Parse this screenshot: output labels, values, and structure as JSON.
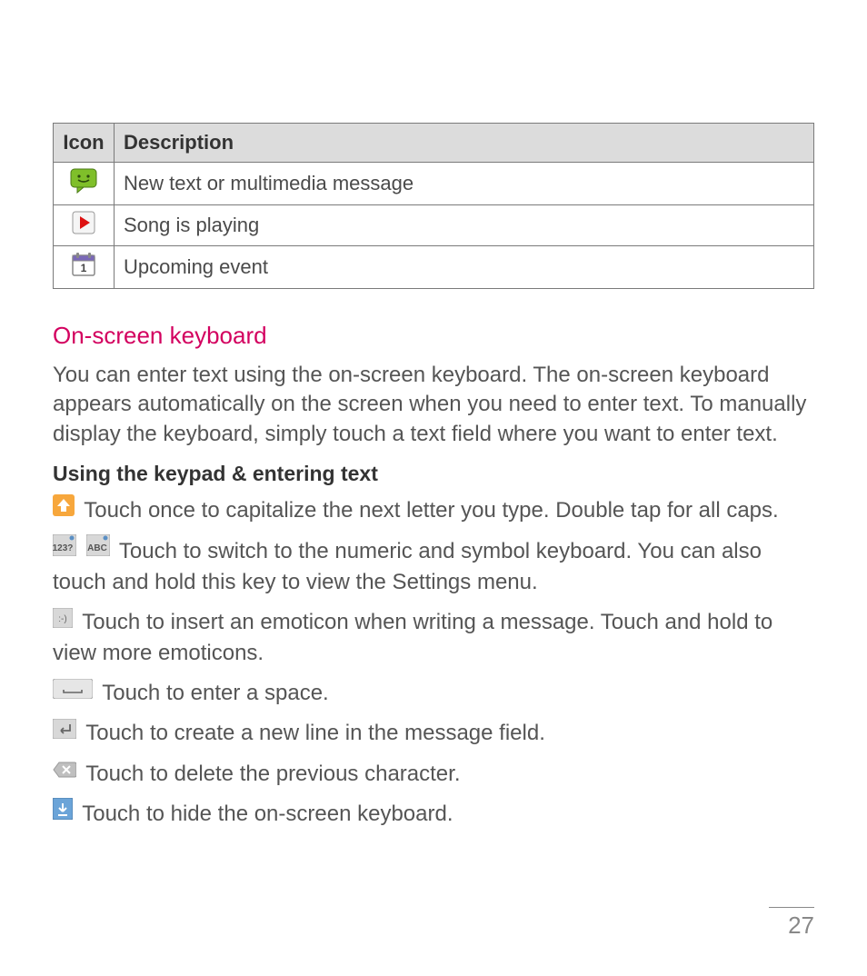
{
  "table": {
    "headers": {
      "icon": "Icon",
      "desc": "Description"
    },
    "rows": [
      {
        "desc": "New text or multimedia message"
      },
      {
        "desc": "Song is playing"
      },
      {
        "desc": "Upcoming event"
      }
    ]
  },
  "section": {
    "heading": "On-screen keyboard",
    "intro": "You can enter text using the on-screen keyboard. The on-screen keyboard appears automatically on the screen when you need to enter text. To manually display the keyboard, simply touch a text field where you want to enter text.",
    "subheading": "Using the keypad & entering text",
    "entries": {
      "shift": "Touch once to capitalize the next letter you type. Double tap for all caps.",
      "numeric": "Touch to switch to the numeric and symbol keyboard. You can also touch and hold this key to view the Settings menu.",
      "emoticon": "Touch to insert an emoticon when writing a message. Touch and hold to view more emoticons.",
      "space": "Touch to enter a space.",
      "newline": "Touch to create a new line in the message field.",
      "delete": "Touch to delete the previous character.",
      "hide": "Touch to hide the on-screen keyboard."
    }
  },
  "pageNumber": "27"
}
